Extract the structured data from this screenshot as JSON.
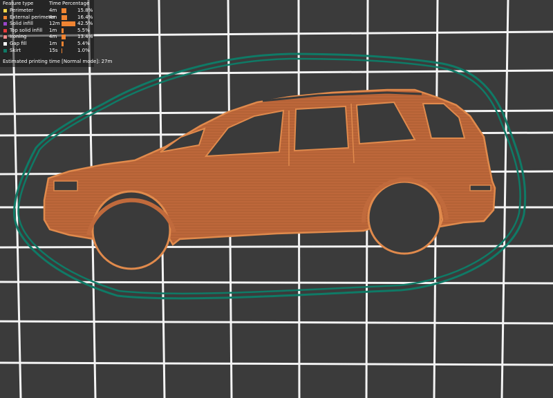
{
  "legend": {
    "header": {
      "feature_type": "Feature type",
      "time": "Time",
      "percentage": "Percentage"
    },
    "rows": [
      {
        "name": "Perimeter",
        "time": "4m",
        "pct": "15.8%",
        "fraction": 0.158,
        "color": "#f5d84a"
      },
      {
        "name": "External perimeter",
        "time": "4m",
        "pct": "16.4%",
        "fraction": 0.164,
        "color": "#f08432"
      },
      {
        "name": "Solid infill",
        "time": "12m",
        "pct": "42.5%",
        "fraction": 0.425,
        "color": "#9a46c9"
      },
      {
        "name": "Top solid infill",
        "time": "1m",
        "pct": "5.5%",
        "fraction": 0.055,
        "color": "#e63b3b"
      },
      {
        "name": "Ironing",
        "time": "4m",
        "pct": "13.4%",
        "fraction": 0.134,
        "color": "#f08c8c"
      },
      {
        "name": "Gap fill",
        "time": "1m",
        "pct": "5.4%",
        "fraction": 0.054,
        "color": "#ffffff"
      },
      {
        "name": "Skirt",
        "time": "15s",
        "pct": "1.0%",
        "fraction": 0.01,
        "color": "#0f7a66"
      }
    ],
    "estimated_time": "Estimated printing time [Normal mode]:  27m"
  },
  "colors": {
    "bed_background": "#3a3a3a",
    "bed_grid": "#ffffff",
    "model_fill": "#c06a3c",
    "model_outline": "#e08a4c",
    "skirt": "#0f7a66"
  }
}
